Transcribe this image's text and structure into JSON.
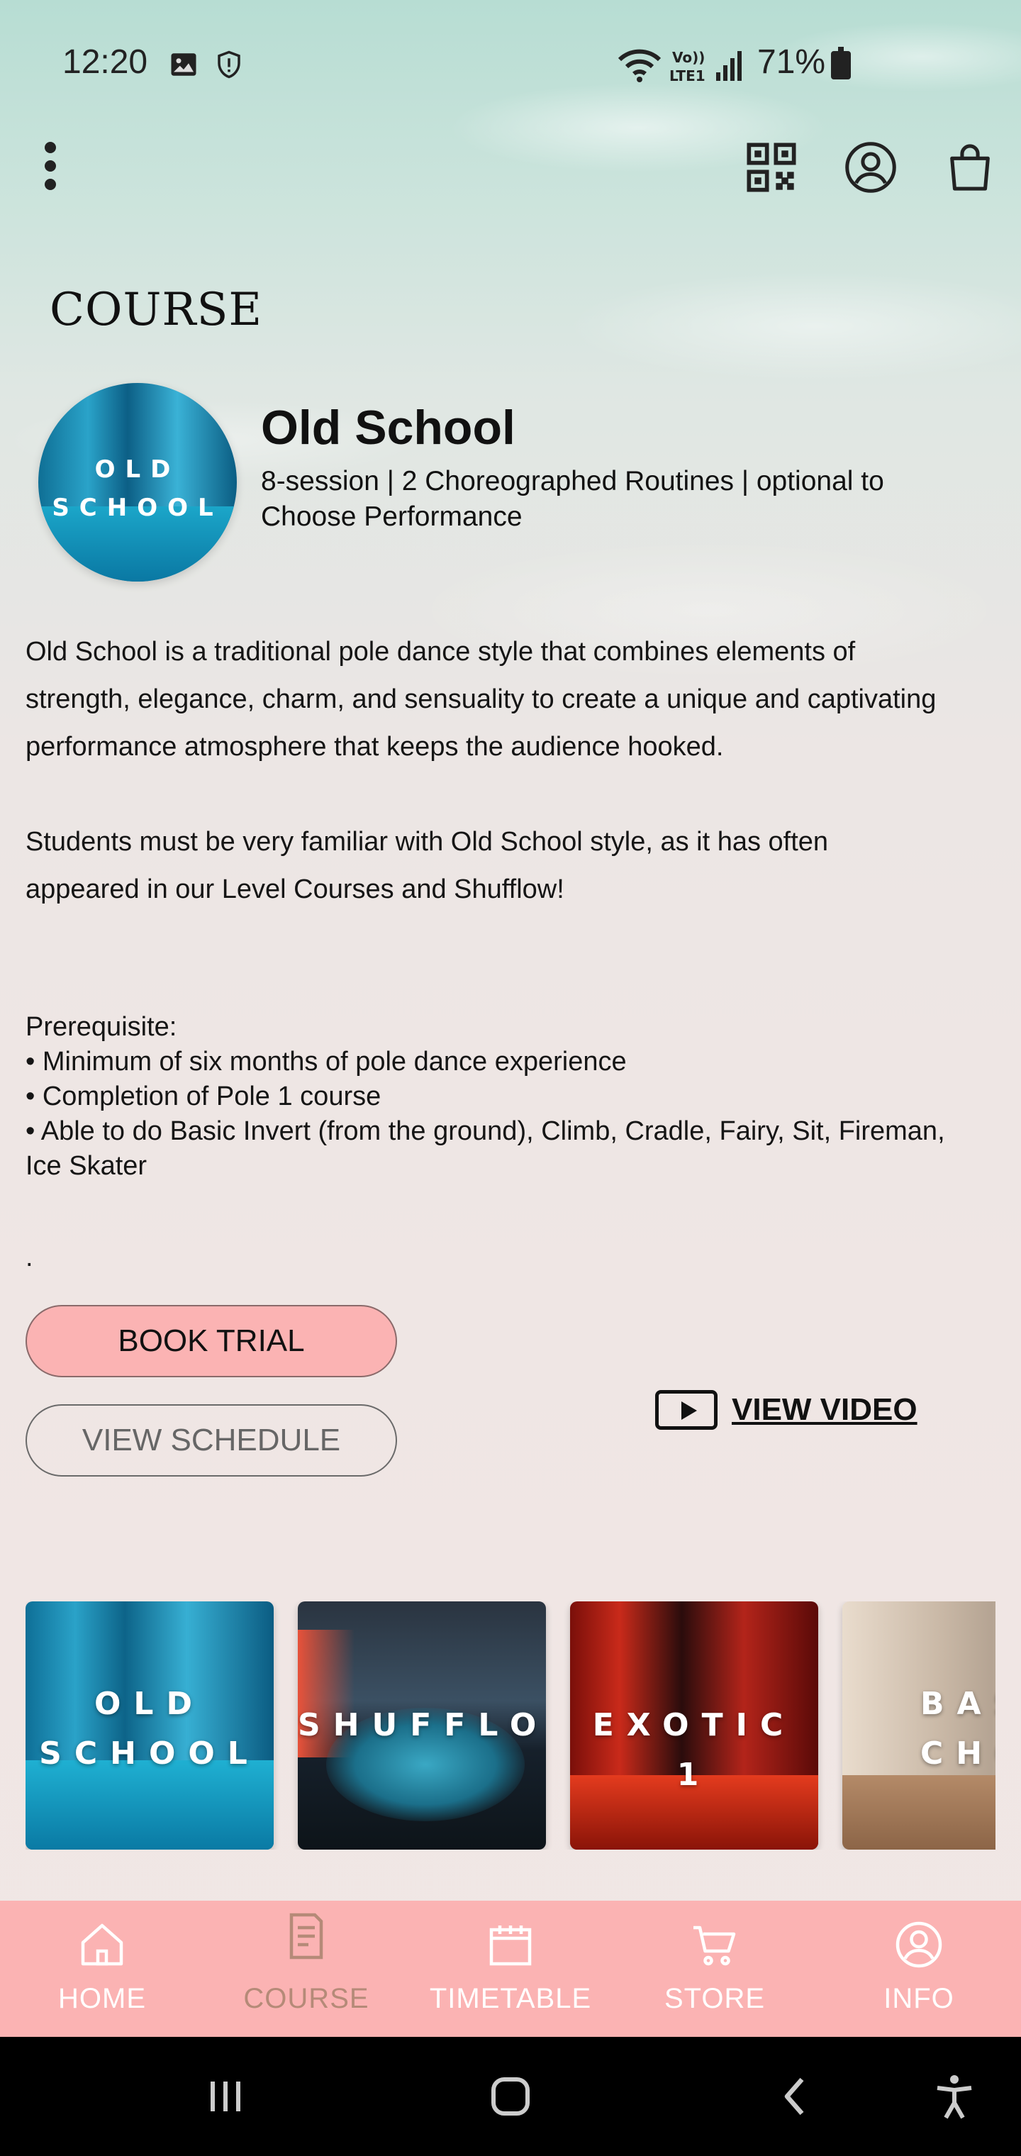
{
  "status_bar": {
    "time": "12:20",
    "battery": "71%",
    "icons": [
      "image-icon",
      "shield-icon",
      "wifi-icon",
      "volte-icon",
      "signal-icon",
      "battery-charging-icon"
    ]
  },
  "toolbar": {
    "icons": [
      "more-vert-icon",
      "qr-code-icon",
      "account-icon",
      "shopping-bag-icon"
    ]
  },
  "page": {
    "section_title": "COURSE"
  },
  "course": {
    "thumb_label_line1": "OLD",
    "thumb_label_line2": "SCHOOL",
    "name": "Old School",
    "subtitle": "8-session | 2 Choreographed Routines | optional to Choose Performance",
    "description_p1_l1": "Old School is a traditional pole dance style that combines elements of",
    "description_p1_l2": "strength, elegance, charm, and sensuality to create a unique and captivating",
    "description_p1_l3": "performance atmosphere that keeps the audience hooked.",
    "description_p2_l1": "Students must be very familiar with Old School style, as it has often",
    "description_p2_l2": "appeared in our Level Courses and Shufflow!",
    "prerequisite_title": "Prerequisite:",
    "prerequisites": [
      "• Minimum of six months of pole dance experience",
      "• Completion of Pole 1 course",
      "• Able to do Basic Invert (from the ground), Climb, Cradle, Fairy, Sit, Fireman,",
      "Ice Skater"
    ],
    "trailing_dot": "."
  },
  "actions": {
    "book_trial": "BOOK TRIAL",
    "view_schedule": "VIEW SCHEDULE",
    "view_video": "VIEW VIDEO"
  },
  "carousel": [
    {
      "line1": "OLD",
      "line2": "SCHOOL"
    },
    {
      "line1": "SHUFFLOW",
      "line2": ""
    },
    {
      "line1": "EXOTIC 1",
      "line2": ""
    },
    {
      "line1": "BAS",
      "line2": "CHOR"
    }
  ],
  "bottom_nav": [
    {
      "label": "HOME",
      "icon": "home-icon",
      "active": false
    },
    {
      "label": "COURSE",
      "icon": "document-icon",
      "active": true
    },
    {
      "label": "TIMETABLE",
      "icon": "calendar-icon",
      "active": false
    },
    {
      "label": "STORE",
      "icon": "cart-icon",
      "active": false
    },
    {
      "label": "INFO",
      "icon": "account-circle-icon",
      "active": false
    }
  ],
  "colors": {
    "accent_pink": "#fbb3b3",
    "active_nav": "#b58a78"
  },
  "system_nav": [
    "recents-icon",
    "home-button-icon",
    "back-icon",
    "accessibility-icon"
  ]
}
